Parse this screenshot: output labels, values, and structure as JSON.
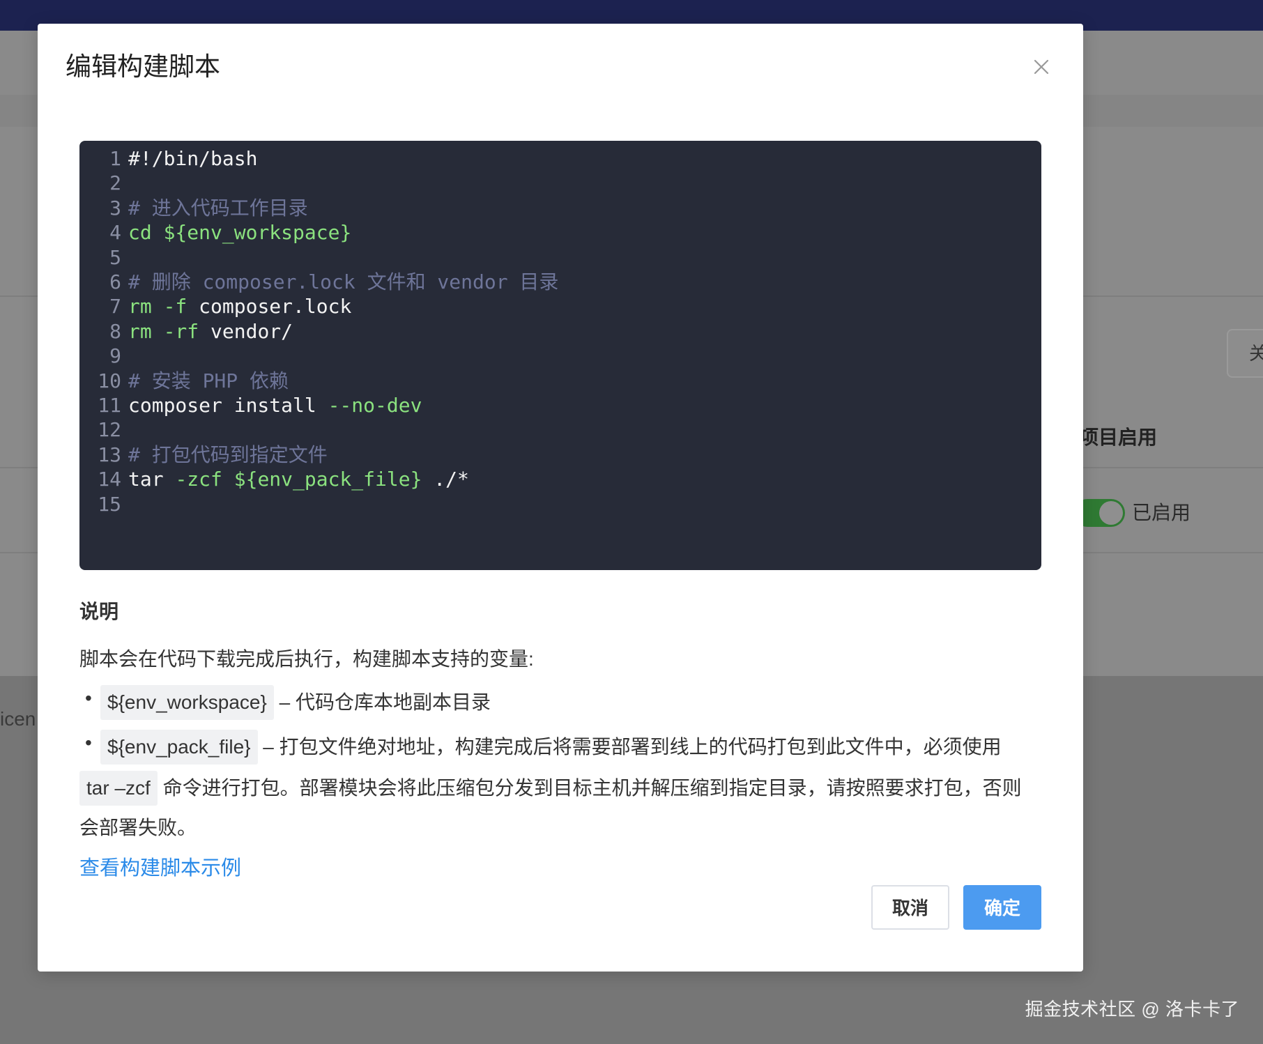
{
  "background": {
    "side_button_label": "关",
    "section_heading": "项目启用",
    "toggle_state_label": "已启用",
    "left_clip_text": "icen",
    "watermark": "掘金技术社区 @ 洛卡卡了"
  },
  "modal": {
    "title": "编辑构建脚本",
    "close_icon": "close-icon",
    "editor": {
      "lines": [
        {
          "no": "1",
          "tokens": [
            {
              "t": "#!/bin/bash",
              "k": "plain"
            }
          ]
        },
        {
          "no": "2",
          "tokens": []
        },
        {
          "no": "3",
          "tokens": [
            {
              "t": "# 进入代码工作目录",
              "k": "comment"
            }
          ]
        },
        {
          "no": "4",
          "tokens": [
            {
              "t": "cd ",
              "k": "cmd"
            },
            {
              "t": "${env_workspace}",
              "k": "var"
            }
          ]
        },
        {
          "no": "5",
          "tokens": []
        },
        {
          "no": "6",
          "tokens": [
            {
              "t": "# 删除 composer.lock 文件和 vendor 目录",
              "k": "comment"
            }
          ]
        },
        {
          "no": "7",
          "tokens": [
            {
              "t": "rm ",
              "k": "cmd"
            },
            {
              "t": "-f ",
              "k": "flag"
            },
            {
              "t": "composer.lock",
              "k": "plain"
            }
          ]
        },
        {
          "no": "8",
          "tokens": [
            {
              "t": "rm ",
              "k": "cmd"
            },
            {
              "t": "-rf ",
              "k": "flag"
            },
            {
              "t": "vendor/",
              "k": "plain"
            }
          ]
        },
        {
          "no": "9",
          "tokens": []
        },
        {
          "no": "10",
          "tokens": [
            {
              "t": "# 安装 PHP 依赖",
              "k": "comment"
            }
          ]
        },
        {
          "no": "11",
          "tokens": [
            {
              "t": "composer install ",
              "k": "plain"
            },
            {
              "t": "--no-dev",
              "k": "flag"
            }
          ]
        },
        {
          "no": "12",
          "tokens": []
        },
        {
          "no": "13",
          "tokens": [
            {
              "t": "# 打包代码到指定文件",
              "k": "comment"
            }
          ]
        },
        {
          "no": "14",
          "tokens": [
            {
              "t": "tar ",
              "k": "plain"
            },
            {
              "t": "-zcf ",
              "k": "flag"
            },
            {
              "t": "${env_pack_file}",
              "k": "var"
            },
            {
              "t": " ./*",
              "k": "plain"
            }
          ]
        },
        {
          "no": "15",
          "tokens": []
        }
      ]
    },
    "description": {
      "heading": "说明",
      "intro": "脚本会在代码下载完成后执行，构建脚本支持的变量:",
      "bullet_symbol": "•",
      "var1": "${env_workspace}",
      "var1_desc": " – 代码仓库本地副本目录",
      "var2": "${env_pack_file}",
      "var2_desc": " – 打包文件绝对地址，构建完成后将需要部署到线上的代码打包到此文件中，必须使用",
      "cmd_chip": "tar –zcf",
      "cmd_desc": " 命令进行打包。部署模块会将此压缩包分发到目标主机并解压缩到指定目录，请按照要求打包，否则",
      "tail": "会部署失败。",
      "example_link": "查看构建脚本示例"
    },
    "buttons": {
      "cancel": "取消",
      "ok": "确定"
    }
  },
  "colors": {
    "code_bg": "#272b38",
    "code_green": "#8be27f",
    "code_comment": "#6e7599",
    "link": "#2a8ae8",
    "primary": "#4c9bf0",
    "topbar": "#1c2250"
  }
}
